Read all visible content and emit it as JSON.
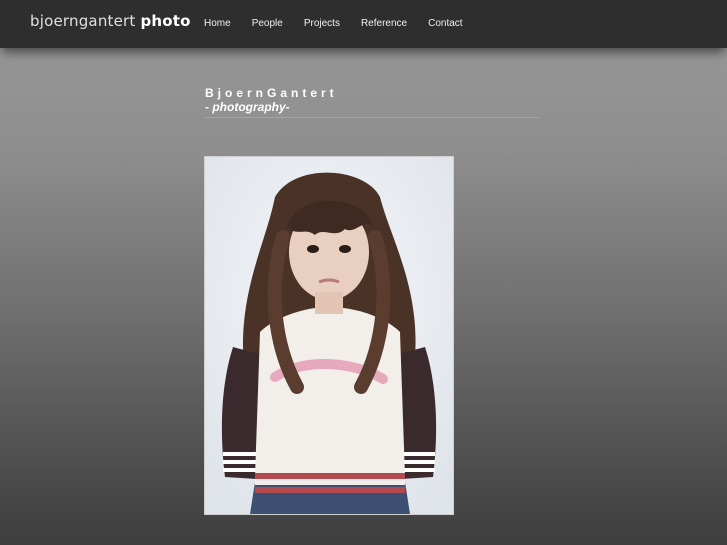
{
  "header": {
    "logo_light": "bjoerngantert",
    "logo_bold": "photo",
    "nav": [
      "Home",
      "People",
      "Projects",
      "Reference",
      "Contact"
    ]
  },
  "main": {
    "title": "BjoernGantert",
    "subtitle": "- photography-"
  },
  "colors": {
    "topbar": "#2e2e2e",
    "text": "#ffffff"
  }
}
